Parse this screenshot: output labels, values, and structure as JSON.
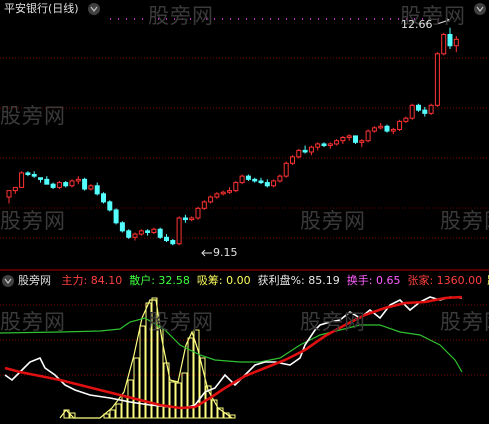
{
  "upper_panel": {
    "title": "平安银行(日线)",
    "high_price_label": "12.66",
    "low_price_label": "9.15",
    "watermark": "股旁网"
  },
  "lower_panel": {
    "indicator_name": "股旁网",
    "items": [
      {
        "label": "主力:",
        "value": "84.10",
        "color": "#ff4040"
      },
      {
        "label": "散户:",
        "value": "32.58",
        "color": "#40ff40"
      },
      {
        "label": "吸筹:",
        "value": "0.00",
        "color": "#ffff60"
      },
      {
        "label": "获利盘%:",
        "value": "85.19",
        "color": "#e8e8e8"
      },
      {
        "label": "换手:",
        "value": "0.65",
        "color": "#ff60ff"
      },
      {
        "label": "张家:",
        "value": "1360.00",
        "color": "#ff4040"
      }
    ],
    "trailing": "路"
  },
  "colors": {
    "up": "#ff3232",
    "down": "#54ffff",
    "grid": "#8b0000",
    "main_line": "#e01010",
    "retail_line": "#30c030",
    "profit_line": "#ffffff",
    "hist": "#ffff80"
  },
  "candles": [
    [
      7.4,
      7.6,
      7.2,
      7.6
    ],
    [
      7.6,
      7.7,
      7.5,
      7.7
    ],
    [
      7.7,
      8.2,
      7.7,
      8.15
    ],
    [
      8.15,
      8.2,
      8.05,
      8.1
    ],
    [
      8.1,
      8.2,
      8.0,
      8.05
    ],
    [
      8.0,
      8.0,
      7.85,
      7.95
    ],
    [
      7.95,
      8.05,
      7.8,
      7.8
    ],
    [
      7.8,
      7.85,
      7.65,
      7.7
    ],
    [
      7.7,
      7.9,
      7.65,
      7.85
    ],
    [
      7.85,
      7.9,
      7.7,
      7.75
    ],
    [
      7.75,
      7.95,
      7.7,
      7.9
    ],
    [
      7.9,
      8.05,
      7.8,
      7.95
    ],
    [
      7.95,
      8.0,
      7.6,
      7.65
    ],
    [
      7.65,
      7.8,
      7.6,
      7.75
    ],
    [
      7.75,
      7.85,
      7.45,
      7.5
    ],
    [
      7.5,
      7.55,
      7.2,
      7.25
    ],
    [
      7.25,
      7.3,
      6.95,
      7.0
    ],
    [
      7.0,
      7.05,
      6.55,
      6.6
    ],
    [
      6.6,
      6.65,
      6.3,
      6.35
    ],
    [
      6.35,
      6.4,
      6.1,
      6.15
    ],
    [
      6.15,
      6.3,
      6.05,
      6.25
    ],
    [
      6.25,
      6.4,
      6.2,
      6.35
    ],
    [
      6.35,
      6.4,
      6.2,
      6.3
    ],
    [
      6.3,
      6.45,
      6.25,
      6.4
    ],
    [
      6.4,
      6.45,
      6.1,
      6.15
    ],
    [
      6.15,
      6.25,
      6.0,
      6.05
    ],
    [
      6.05,
      6.1,
      5.9,
      5.95
    ],
    [
      5.95,
      6.8,
      5.9,
      6.75
    ],
    [
      6.75,
      6.85,
      6.6,
      6.7
    ],
    [
      6.7,
      6.8,
      6.65,
      6.75
    ],
    [
      6.75,
      7.1,
      6.7,
      7.05
    ],
    [
      7.05,
      7.3,
      7.0,
      7.25
    ],
    [
      7.25,
      7.45,
      7.2,
      7.4
    ],
    [
      7.4,
      7.55,
      7.35,
      7.5
    ],
    [
      7.5,
      7.6,
      7.45,
      7.55
    ],
    [
      7.55,
      7.7,
      7.5,
      7.6
    ],
    [
      7.6,
      7.9,
      7.55,
      7.85
    ],
    [
      7.85,
      8.1,
      7.8,
      8.05
    ],
    [
      8.05,
      8.1,
      7.9,
      7.95
    ],
    [
      7.95,
      8.0,
      7.85,
      7.9
    ],
    [
      7.9,
      8.0,
      7.8,
      7.85
    ],
    [
      7.85,
      7.95,
      7.7,
      7.75
    ],
    [
      7.75,
      7.95,
      7.7,
      7.9
    ],
    [
      7.9,
      8.1,
      7.85,
      8.05
    ],
    [
      8.05,
      8.5,
      8.0,
      8.45
    ],
    [
      8.45,
      8.7,
      8.4,
      8.65
    ],
    [
      8.65,
      8.9,
      8.6,
      8.85
    ],
    [
      8.85,
      9.0,
      8.75,
      8.8
    ],
    [
      8.8,
      9.0,
      8.7,
      8.95
    ],
    [
      8.95,
      9.1,
      8.85,
      9.05
    ],
    [
      9.05,
      9.1,
      8.95,
      9.0
    ],
    [
      9.0,
      9.1,
      8.9,
      9.05
    ],
    [
      9.05,
      9.2,
      9.0,
      9.15
    ],
    [
      9.15,
      9.3,
      9.05,
      9.25
    ],
    [
      9.25,
      9.35,
      9.15,
      9.3
    ],
    [
      9.3,
      9.3,
      9.05,
      9.1
    ],
    [
      9.1,
      9.2,
      8.95,
      9.15
    ],
    [
      9.15,
      9.5,
      9.1,
      9.45
    ],
    [
      9.45,
      9.6,
      9.4,
      9.55
    ],
    [
      9.55,
      9.7,
      9.5,
      9.6
    ],
    [
      9.6,
      9.65,
      9.4,
      9.45
    ],
    [
      9.45,
      9.55,
      9.35,
      9.5
    ],
    [
      9.5,
      9.8,
      9.45,
      9.75
    ],
    [
      9.75,
      9.9,
      9.7,
      9.85
    ],
    [
      9.85,
      10.3,
      9.8,
      10.25
    ],
    [
      10.25,
      10.3,
      10.05,
      10.1
    ],
    [
      10.1,
      10.2,
      9.9,
      10.0
    ],
    [
      10.0,
      10.3,
      9.95,
      10.25
    ],
    [
      10.25,
      11.9,
      10.2,
      11.85
    ],
    [
      11.85,
      12.5,
      11.8,
      12.45
    ],
    [
      12.45,
      12.66,
      12.0,
      12.1
    ],
    [
      12.1,
      12.4,
      11.9,
      12.3
    ]
  ]
}
